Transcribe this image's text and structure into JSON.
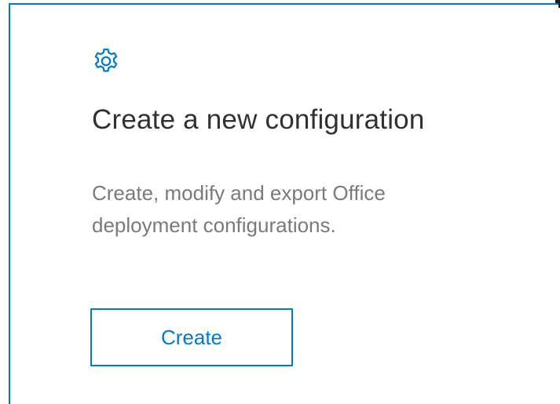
{
  "card": {
    "icon": "gear-icon",
    "title": "Create a new configuration",
    "description": "Create, modify and export Office deployment configurations.",
    "button_label": "Create"
  },
  "colors": {
    "accent": "#0078d4",
    "title": "#323130",
    "description": "#7a7a7a"
  }
}
